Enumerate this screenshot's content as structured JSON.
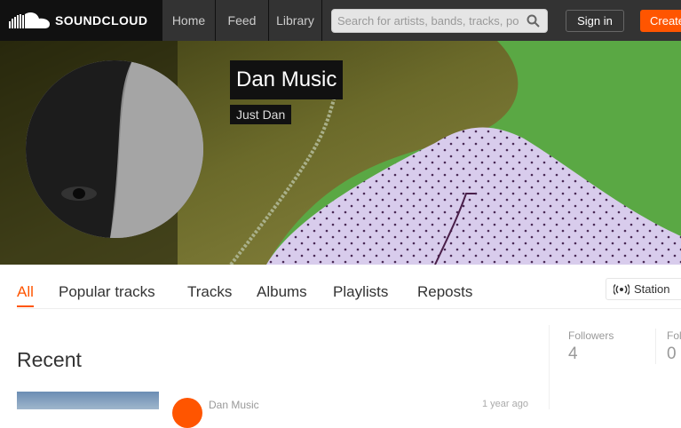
{
  "header": {
    "brand": "SOUNDCLOUD",
    "nav": [
      "Home",
      "Feed",
      "Library"
    ],
    "search_placeholder": "Search for artists, bands, tracks, po",
    "signin_label": "Sign in",
    "create_label": "Create"
  },
  "profile": {
    "name": "Dan Music",
    "subtitle": "Just Dan"
  },
  "tabs": [
    "All",
    "Popular tracks",
    "Tracks",
    "Albums",
    "Playlists",
    "Reposts"
  ],
  "active_tab": "All",
  "station_label": "Station",
  "main": {
    "section_title": "Recent",
    "track": {
      "user": "Dan Music",
      "time": "1 year ago"
    }
  },
  "stats": [
    {
      "label": "Followers",
      "value": "4"
    },
    {
      "label": "Fol",
      "value": "0"
    }
  ],
  "colors": {
    "accent": "#ff5500",
    "topbar": "#333333"
  }
}
